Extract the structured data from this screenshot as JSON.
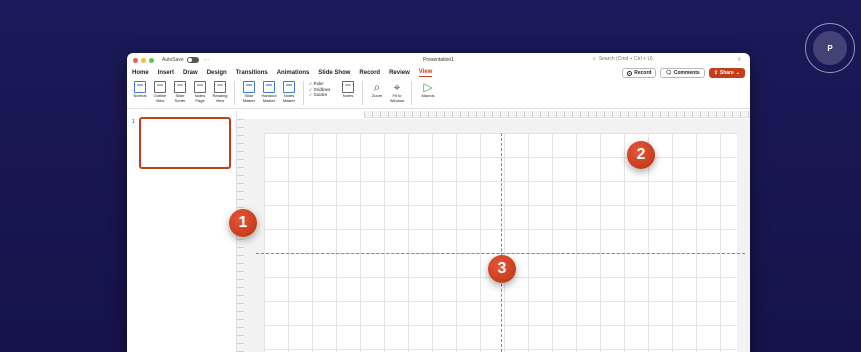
{
  "titlebar": {
    "autosave_label": "AutoSave",
    "more_label": "···",
    "doc_title": "Presentation1",
    "search_placeholder": "Search (Cmd + Ctrl + U)"
  },
  "ribbon": {
    "tabs": [
      "Home",
      "Insert",
      "Draw",
      "Design",
      "Transitions",
      "Animations",
      "Slide Show",
      "Record",
      "Review",
      "View"
    ],
    "active_tab": "View",
    "record_label": "Record",
    "comments_label": "Comments",
    "share_label": "Share"
  },
  "toolbar": {
    "normal": "Normal",
    "outline_view": "Outline View",
    "slide_sorter": "Slide Sorter",
    "notes_page": "Notes Page",
    "reading_view": "Reading View",
    "slide_master": "Slide Master",
    "handout_master": "Handout Master",
    "notes_master": "Notes Master",
    "ruler": "✓ Ruler",
    "gridlines": "✓ Gridlines",
    "guides": "✓ Guides",
    "notes": "Notes",
    "zoom": "Zoom",
    "fit_to_window": "Fit to Window",
    "macros": "Macros"
  },
  "thumbnails": {
    "slide_number": "1"
  },
  "markers": [
    "1",
    "2",
    "3"
  ],
  "colors": {
    "accent": "#c43e1c",
    "background": "#1b1a5a",
    "guide": "#5b8fd6",
    "marker": "#d64a2a"
  },
  "icons": {
    "search": "search-icon",
    "share": "share-icon",
    "comments": "comment-icon",
    "record": "record-icon"
  }
}
